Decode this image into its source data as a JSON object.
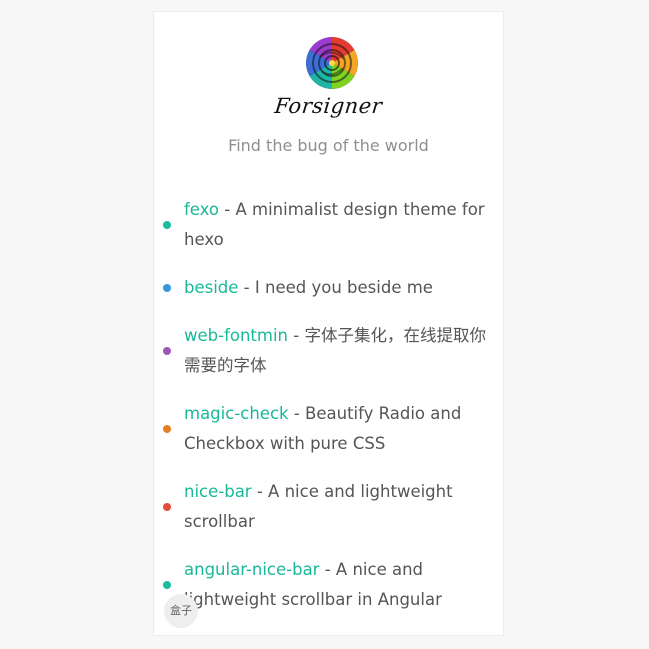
{
  "header": {
    "brand": "Forsigner",
    "tagline": "Find the bug of the world"
  },
  "avatar": {
    "icon": "rainbow-rose-icon"
  },
  "projects": [
    {
      "name": "fexo",
      "separator": " - ",
      "description": "A minimalist design theme for hexo",
      "dot_color": "#1abc9c"
    },
    {
      "name": "beside",
      "separator": " - ",
      "description": "I need you beside me",
      "dot_color": "#3498db"
    },
    {
      "name": "web-fontmin",
      "separator": " - ",
      "description": "字体子集化，在线提取你需要的字体",
      "dot_color": "#9b59b6"
    },
    {
      "name": "magic-check",
      "separator": " - ",
      "description": "Beautify Radio and Checkbox with pure CSS",
      "dot_color": "#e67e22"
    },
    {
      "name": "nice-bar",
      "separator": " - ",
      "description": "A nice and lightweight scrollbar",
      "dot_color": "#e74c3c"
    },
    {
      "name": "angular-nice-bar",
      "separator": " - ",
      "description": "A nice and lightweight scrollbar in Angular",
      "dot_color": "#1abc9c"
    }
  ],
  "floating_badge": {
    "label": "盒子"
  }
}
